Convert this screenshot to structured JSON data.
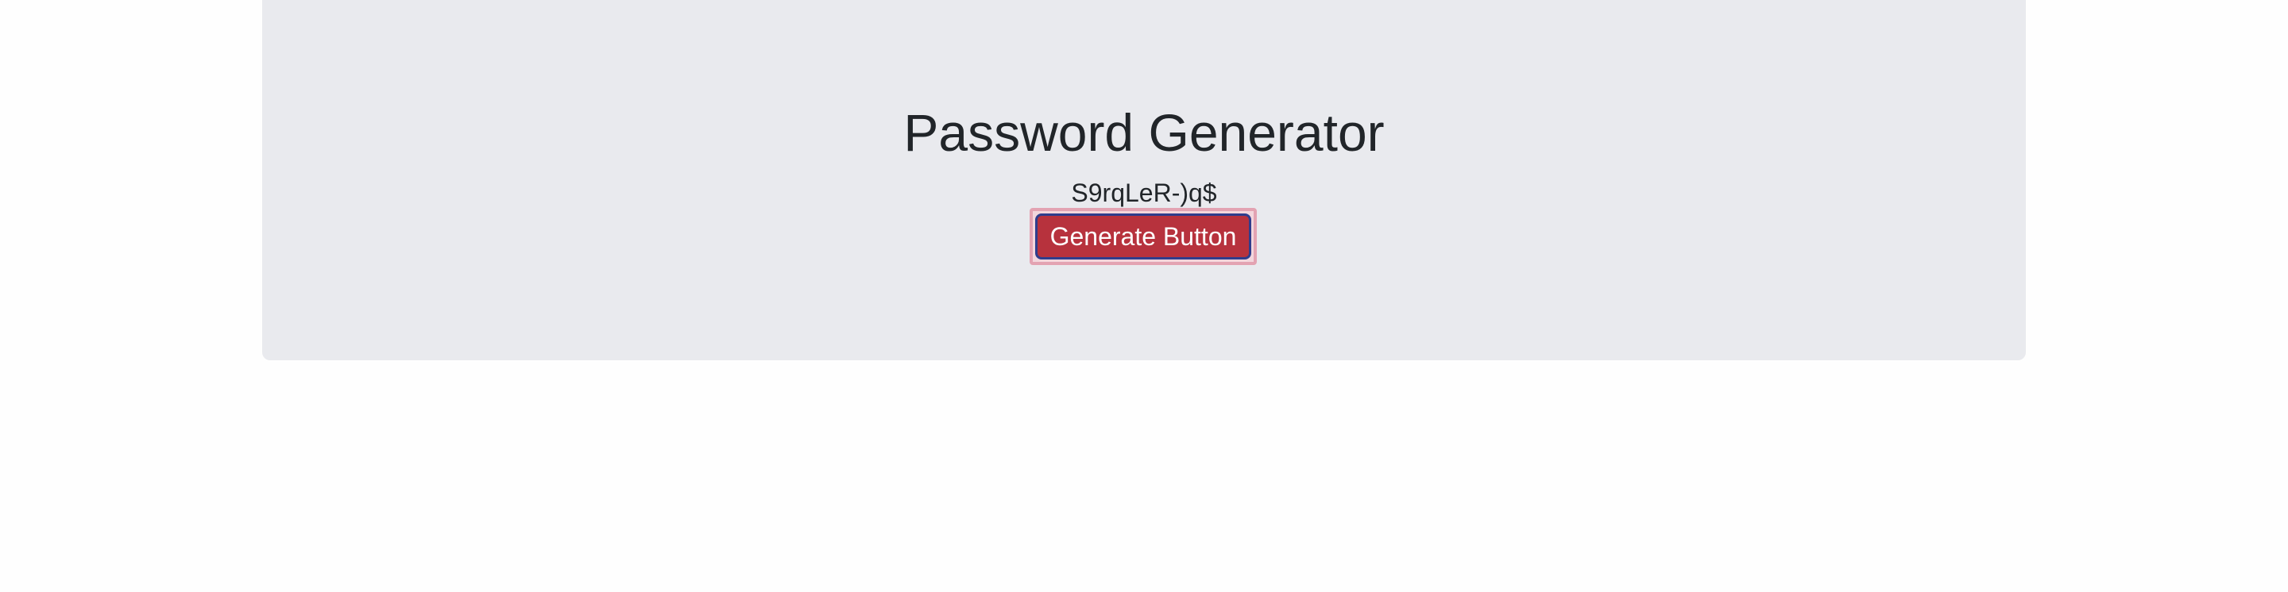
{
  "header": {
    "title": "Password Generator"
  },
  "main": {
    "password": "S9rqLeR-)q$",
    "generate_label": "Generate Button"
  },
  "colors": {
    "background": "#fefefe",
    "panel": "#e9eaee",
    "button": "#b7323d",
    "button_border": "#2f3d8c",
    "focus_ring": "#e3a3b2",
    "text": "#212529"
  }
}
